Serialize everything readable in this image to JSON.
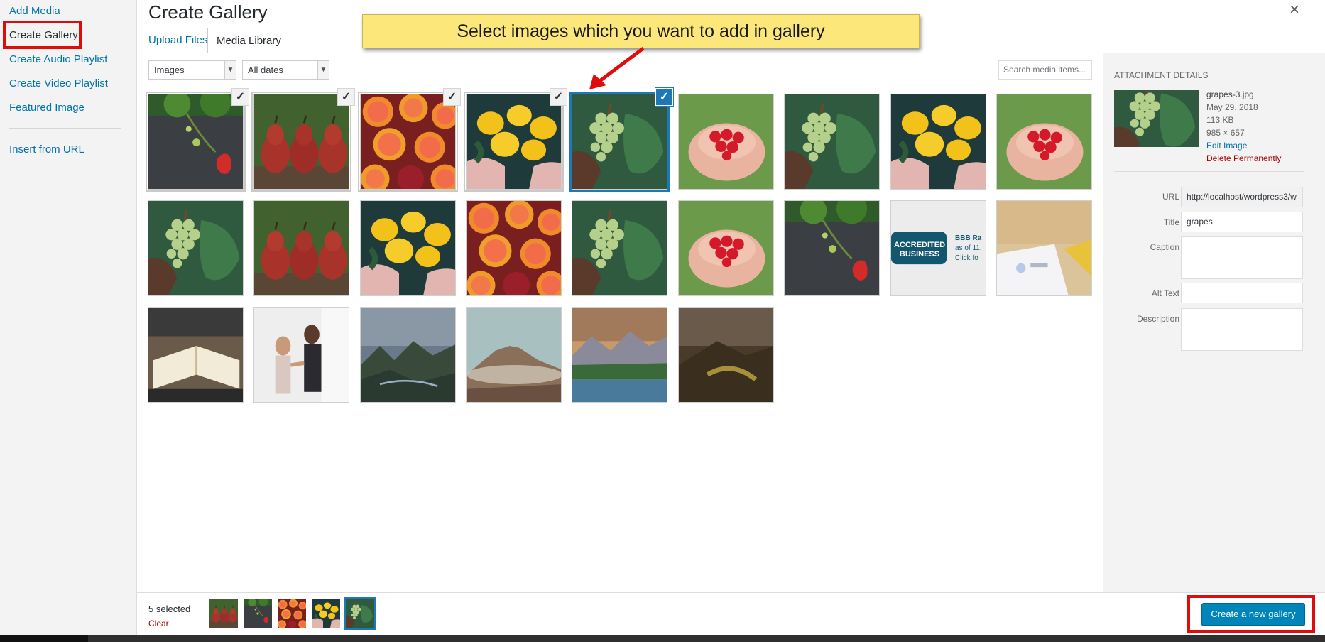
{
  "menu": {
    "items": [
      {
        "label": "Add Media"
      },
      {
        "label": "Create Gallery"
      },
      {
        "label": "Create Audio Playlist"
      },
      {
        "label": "Create Video Playlist"
      },
      {
        "label": "Featured Image"
      },
      {
        "label": "Insert from URL"
      }
    ],
    "active": "Create Gallery"
  },
  "header": {
    "title": "Create Gallery",
    "close_glyph": "×",
    "tabs": [
      {
        "label": "Upload Files"
      },
      {
        "label": "Media Library"
      }
    ],
    "active_tab": "Media Library"
  },
  "callout": {
    "text": "Select images which you want to add in gallery"
  },
  "toolbar": {
    "filter_type": "Images",
    "filter_date": "All dates",
    "search_placeholder": "Search media items..."
  },
  "grid": {
    "items": [
      {
        "image": "strawberry",
        "selected": true
      },
      {
        "image": "pears",
        "selected": true
      },
      {
        "image": "grapefruit",
        "selected": true
      },
      {
        "image": "lemons",
        "selected": true
      },
      {
        "image": "grapes",
        "selected": true,
        "focused": true
      },
      {
        "image": "cherries",
        "selected": false
      },
      {
        "image": "grapes",
        "selected": false
      },
      {
        "image": "lemons",
        "selected": false
      },
      {
        "image": "cherries",
        "selected": false
      },
      {
        "image": "grapes",
        "selected": false
      },
      {
        "image": "pears",
        "selected": false
      },
      {
        "image": "lemons",
        "selected": false
      },
      {
        "image": "grapefruit",
        "selected": false
      },
      {
        "image": "grapes",
        "selected": false
      },
      {
        "image": "cherries",
        "selected": false
      },
      {
        "image": "strawberry",
        "selected": false
      },
      {
        "image": "bbb-badge",
        "selected": false,
        "text_lines": [
          "ACCREDITED",
          "BUSINESS",
          "BBB Ra",
          "as of 11,",
          "Click fo"
        ]
      },
      {
        "image": "desk-papers",
        "selected": false
      },
      {
        "image": "notebook",
        "selected": false
      },
      {
        "image": "handshake",
        "selected": false
      },
      {
        "image": "mountain-valley",
        "selected": false
      },
      {
        "image": "volcano",
        "selected": false
      },
      {
        "image": "lake-mountains",
        "selected": false
      },
      {
        "image": "dark-hills",
        "selected": false
      }
    ]
  },
  "details": {
    "heading": "ATTACHMENT DETAILS",
    "filename": "grapes-3.jpg",
    "date": "May 29, 2018",
    "size": "113 KB",
    "dimensions": "985 × 657",
    "edit_link": "Edit Image",
    "delete_link": "Delete Permanently",
    "fields": {
      "url_label": "URL",
      "url_value": "http://localhost/wordpress3/w",
      "title_label": "Title",
      "title_value": "grapes",
      "caption_label": "Caption",
      "caption_value": "",
      "alt_label": "Alt Text",
      "alt_value": "",
      "description_label": "Description",
      "description_value": ""
    }
  },
  "footer": {
    "selected_count": "5 selected",
    "clear_label": "Clear",
    "mini_thumbs": [
      "pears",
      "strawberry",
      "grapefruit",
      "lemons",
      "grapes"
    ],
    "create_button": "Create a new gallery"
  },
  "colors": {
    "accent": "#0073aa",
    "primary_button": "#0085ba",
    "selection_blue": "#1e78b4",
    "delete_red": "#aa0000",
    "annotation_red": "#e00b0b",
    "callout_yellow": "#fce77a"
  }
}
